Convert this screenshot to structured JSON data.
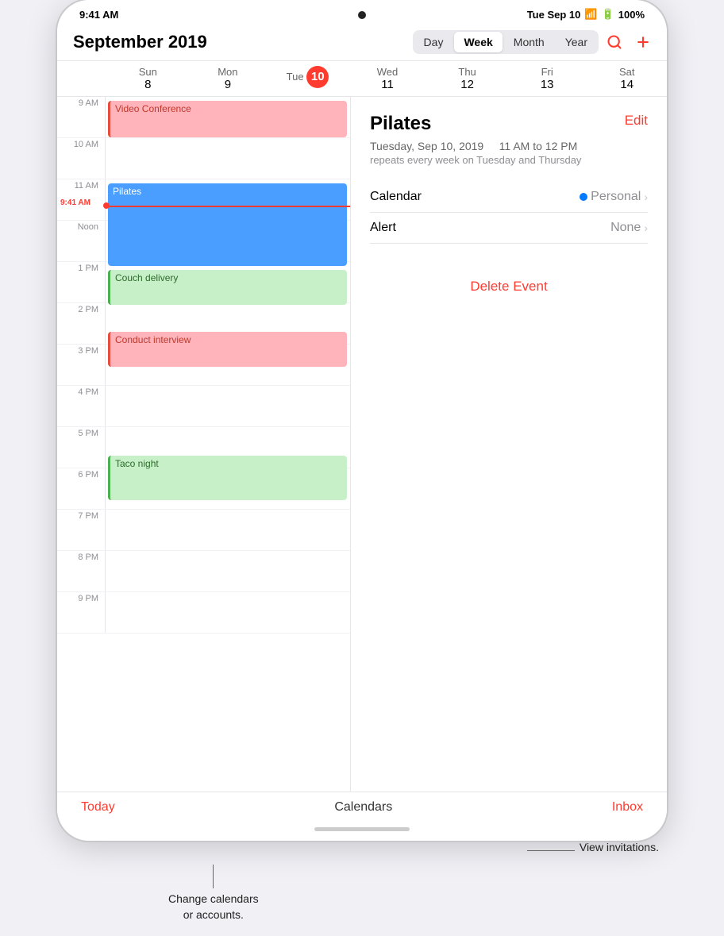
{
  "statusBar": {
    "time": "9:41 AM",
    "date": "Tue Sep 10",
    "wifi": "WiFi",
    "battery": "100%"
  },
  "header": {
    "title": "September 2019",
    "views": [
      "Day",
      "Week",
      "Month",
      "Year"
    ],
    "activeView": "Week"
  },
  "dayHeaders": [
    {
      "day": "Sun",
      "num": "8",
      "today": false
    },
    {
      "day": "Mon",
      "num": "9",
      "today": false
    },
    {
      "day": "Tue",
      "num": "10",
      "today": true
    },
    {
      "day": "Wed",
      "num": "11",
      "today": false
    },
    {
      "day": "Thu",
      "num": "12",
      "today": false
    },
    {
      "day": "Fri",
      "num": "13",
      "today": false
    },
    {
      "day": "Sat",
      "num": "14",
      "today": false
    }
  ],
  "timeSlots": [
    "9 AM",
    "10 AM",
    "11 AM",
    "Noon",
    "1 PM",
    "2 PM",
    "3 PM",
    "4 PM",
    "5 PM",
    "6 PM",
    "7 PM",
    "8 PM",
    "9 PM"
  ],
  "currentTime": "9:41 AM",
  "events": [
    {
      "id": "video-conference",
      "title": "Video Conference",
      "type": "pink",
      "topPx": 8,
      "heightPx": 50
    },
    {
      "id": "pilates",
      "title": "Pilates",
      "type": "blue",
      "topPx": 113,
      "heightPx": 56
    },
    {
      "id": "couch-delivery",
      "title": "Couch delivery",
      "type": "green",
      "topPx": 217,
      "heightPx": 40
    },
    {
      "id": "conduct-interview",
      "title": "Conduct interview",
      "type": "pink",
      "topPx": 295,
      "heightPx": 40
    },
    {
      "id": "taco-night",
      "title": "Taco night",
      "type": "green",
      "topPx": 451,
      "heightPx": 56
    }
  ],
  "eventDetail": {
    "title": "Pilates",
    "editLabel": "Edit",
    "date": "Tuesday, Sep 10, 2019",
    "time": "11 AM to 12 PM",
    "repeat": "repeats every week on Tuesday and Thursday",
    "calendarLabel": "Calendar",
    "calendarValue": "Personal",
    "alertLabel": "Alert",
    "alertValue": "None",
    "deleteLabel": "Delete Event"
  },
  "tabBar": {
    "today": "Today",
    "calendars": "Calendars",
    "inbox": "Inbox"
  },
  "annotations": {
    "inbox": "View invitations.",
    "calendars": "Change calendars\nor accounts."
  }
}
